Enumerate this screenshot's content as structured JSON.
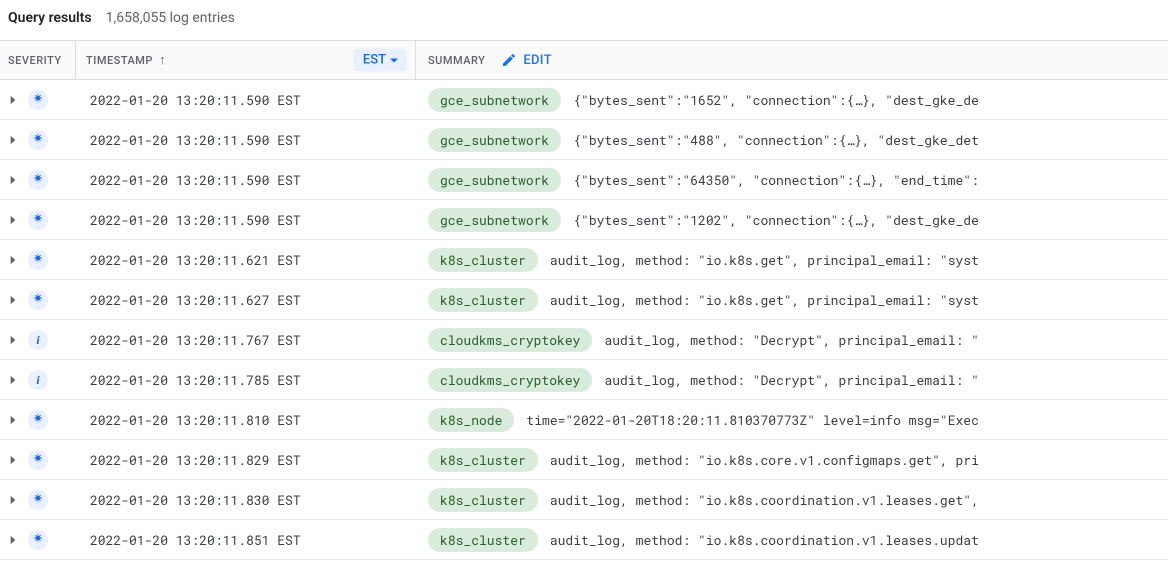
{
  "header": {
    "title": "Query results",
    "count": "1,658,055 log entries"
  },
  "columns": {
    "severity": "SEVERITY",
    "timestamp": "TIMESTAMP",
    "summary": "SUMMARY",
    "timezone": "EST",
    "edit": "EDIT"
  },
  "rows": [
    {
      "sev": "default",
      "ts": "2022-01-20 13:20:11.590 EST",
      "res": "gce_subnetwork",
      "text": "{\"bytes_sent\":\"1652\", \"connection\":{…}, \"dest_gke_de"
    },
    {
      "sev": "default",
      "ts": "2022-01-20 13:20:11.590 EST",
      "res": "gce_subnetwork",
      "text": "{\"bytes_sent\":\"488\", \"connection\":{…}, \"dest_gke_det"
    },
    {
      "sev": "default",
      "ts": "2022-01-20 13:20:11.590 EST",
      "res": "gce_subnetwork",
      "text": "{\"bytes_sent\":\"64350\", \"connection\":{…}, \"end_time\":"
    },
    {
      "sev": "default",
      "ts": "2022-01-20 13:20:11.590 EST",
      "res": "gce_subnetwork",
      "text": "{\"bytes_sent\":\"1202\", \"connection\":{…}, \"dest_gke_de"
    },
    {
      "sev": "default",
      "ts": "2022-01-20 13:20:11.621 EST",
      "res": "k8s_cluster",
      "text": "audit_log, method: \"io.k8s.get\", principal_email: \"syst"
    },
    {
      "sev": "default",
      "ts": "2022-01-20 13:20:11.627 EST",
      "res": "k8s_cluster",
      "text": "audit_log, method: \"io.k8s.get\", principal_email: \"syst"
    },
    {
      "sev": "info",
      "ts": "2022-01-20 13:20:11.767 EST",
      "res": "cloudkms_cryptokey",
      "text": "audit_log, method: \"Decrypt\", principal_email: \""
    },
    {
      "sev": "info",
      "ts": "2022-01-20 13:20:11.785 EST",
      "res": "cloudkms_cryptokey",
      "text": "audit_log, method: \"Decrypt\", principal_email: \""
    },
    {
      "sev": "default",
      "ts": "2022-01-20 13:20:11.810 EST",
      "res": "k8s_node",
      "text": "time=\"2022-01-20T18:20:11.810370773Z\" level=info msg=\"Exec"
    },
    {
      "sev": "default",
      "ts": "2022-01-20 13:20:11.829 EST",
      "res": "k8s_cluster",
      "text": "audit_log, method: \"io.k8s.core.v1.configmaps.get\", pri"
    },
    {
      "sev": "default",
      "ts": "2022-01-20 13:20:11.830 EST",
      "res": "k8s_cluster",
      "text": "audit_log, method: \"io.k8s.coordination.v1.leases.get\","
    },
    {
      "sev": "default",
      "ts": "2022-01-20 13:20:11.851 EST",
      "res": "k8s_cluster",
      "text": "audit_log, method: \"io.k8s.coordination.v1.leases.updat"
    }
  ]
}
